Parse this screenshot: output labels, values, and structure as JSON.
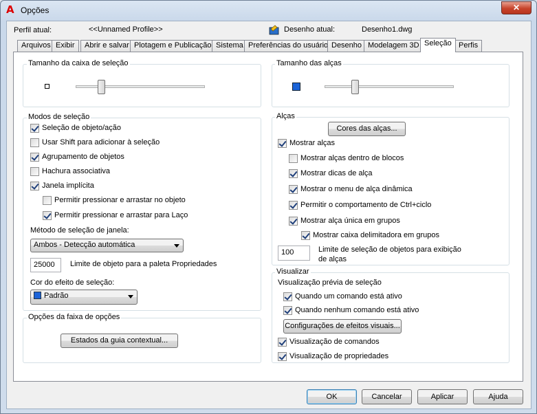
{
  "window": {
    "title": "Opções",
    "close_symbol": "✕"
  },
  "header": {
    "profile_label": "Perfil atual:",
    "profile_value": "<<Unnamed Profile>>",
    "drawing_label": "Desenho atual:",
    "drawing_value": "Desenho1.dwg"
  },
  "tabs": [
    "Arquivos",
    "Exibir",
    "Abrir e salvar",
    "Plotagem e Publicação",
    "Sistema",
    "Preferências do usuário",
    "Desenho",
    "Modelagem 3D",
    "Seleção",
    "Perfis"
  ],
  "active_tab": "Seleção",
  "pickbox": {
    "title": "Tamanho da caixa de seleção",
    "level": 0.18
  },
  "selection_modes": {
    "title": "Modos de seleção",
    "items": [
      {
        "label": "Seleção de objeto/ação",
        "checked": true
      },
      {
        "label": "Usar Shift para adicionar à seleção",
        "checked": false
      },
      {
        "label": "Agrupamento de objetos",
        "checked": true
      },
      {
        "label": "Hachura associativa",
        "checked": false
      },
      {
        "label": "Janela implícita",
        "checked": true
      },
      {
        "label": "Permitir pressionar e arrastar no objeto",
        "checked": false
      },
      {
        "label": "Permitir pressionar e arrastar para Laço",
        "checked": true
      }
    ],
    "window_method_label": "Método de seleção de janela:",
    "window_method_value": "Ambos - Detecção automática",
    "object_limit_value": "25000",
    "object_limit_label": "Limite de objeto para a paleta Propriedades",
    "effect_color_label": "Cor do efeito de seleção:",
    "effect_color_value": "Padrão",
    "effect_color": "#1c64d8"
  },
  "ribbon": {
    "title": "Opções da faixa de opções",
    "button": "Estados da guia contextual..."
  },
  "grip_size": {
    "title": "Tamanho das alças",
    "level": 0.22,
    "swatch_color": "#1c64d8"
  },
  "grips": {
    "title": "Alças",
    "colors_button": "Cores das alças...",
    "items": [
      {
        "label": "Mostrar alças",
        "checked": true
      },
      {
        "label": "Mostrar alças dentro de blocos",
        "checked": false
      },
      {
        "label": "Mostrar dicas de alça",
        "checked": true
      },
      {
        "label": "Mostrar o menu de alça dinâmica",
        "checked": true
      },
      {
        "label": "Permitir o comportamento de Ctrl+ciclo",
        "checked": true
      },
      {
        "label": "Mostrar alça única em grupos",
        "checked": true
      },
      {
        "label": "Mostrar caixa delimitadora em grupos",
        "checked": true
      }
    ],
    "limit_value": "100",
    "limit_label_1": "Limite de seleção de objetos para exibição",
    "limit_label_2": "de alças"
  },
  "preview": {
    "title": "Visualizar",
    "subtitle": "Visualização prévia de seleção",
    "items": [
      {
        "label": "Quando um comando está ativo",
        "checked": true
      },
      {
        "label": "Quando nenhum comando está ativo",
        "checked": true
      }
    ],
    "effects_button": "Configurações de efeitos visuais...",
    "items2": [
      {
        "label": "Visualização de comandos",
        "checked": true
      },
      {
        "label": "Visualização de propriedades",
        "checked": true
      }
    ]
  },
  "footer": {
    "ok": "OK",
    "cancel": "Cancelar",
    "apply": "Aplicar",
    "help": "Ajuda"
  }
}
